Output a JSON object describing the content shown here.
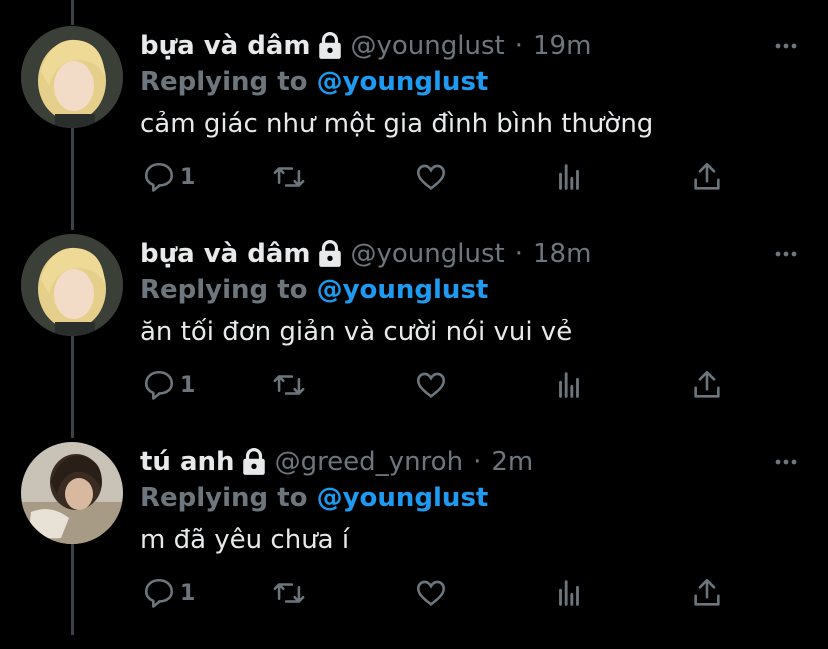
{
  "icons": {
    "reply": "reply-icon",
    "retweet": "retweet-icon",
    "like": "heart-icon",
    "analytics": "analytics-icon",
    "share": "share-icon",
    "lock": "lock-icon",
    "more": "more-icon"
  },
  "colors": {
    "background": "#000000",
    "text": "#e7e9ea",
    "muted": "#6e767d",
    "accent": "#1d9bf0",
    "thread_line": "#3d4145"
  },
  "tweets": [
    {
      "name": "bựa và dâm",
      "handle": "@younglust",
      "dot": "·",
      "time": "19m",
      "reply_prefix": "Replying to",
      "reply_target": "@younglust",
      "text": "cảm giác như một gia đình bình thường",
      "reply_count": "1"
    },
    {
      "name": "bựa và dâm",
      "handle": "@younglust",
      "dot": "·",
      "time": "18m",
      "reply_prefix": "Replying to",
      "reply_target": "@younglust",
      "text": "ăn tối đơn giản và cười nói vui vẻ",
      "reply_count": "1"
    },
    {
      "name": "tú anh",
      "handle": "@greed_ynroh",
      "dot": "·",
      "time": "2m",
      "reply_prefix": "Replying to",
      "reply_target": "@younglust",
      "text": "m đã yêu chưa í",
      "reply_count": "1"
    }
  ]
}
